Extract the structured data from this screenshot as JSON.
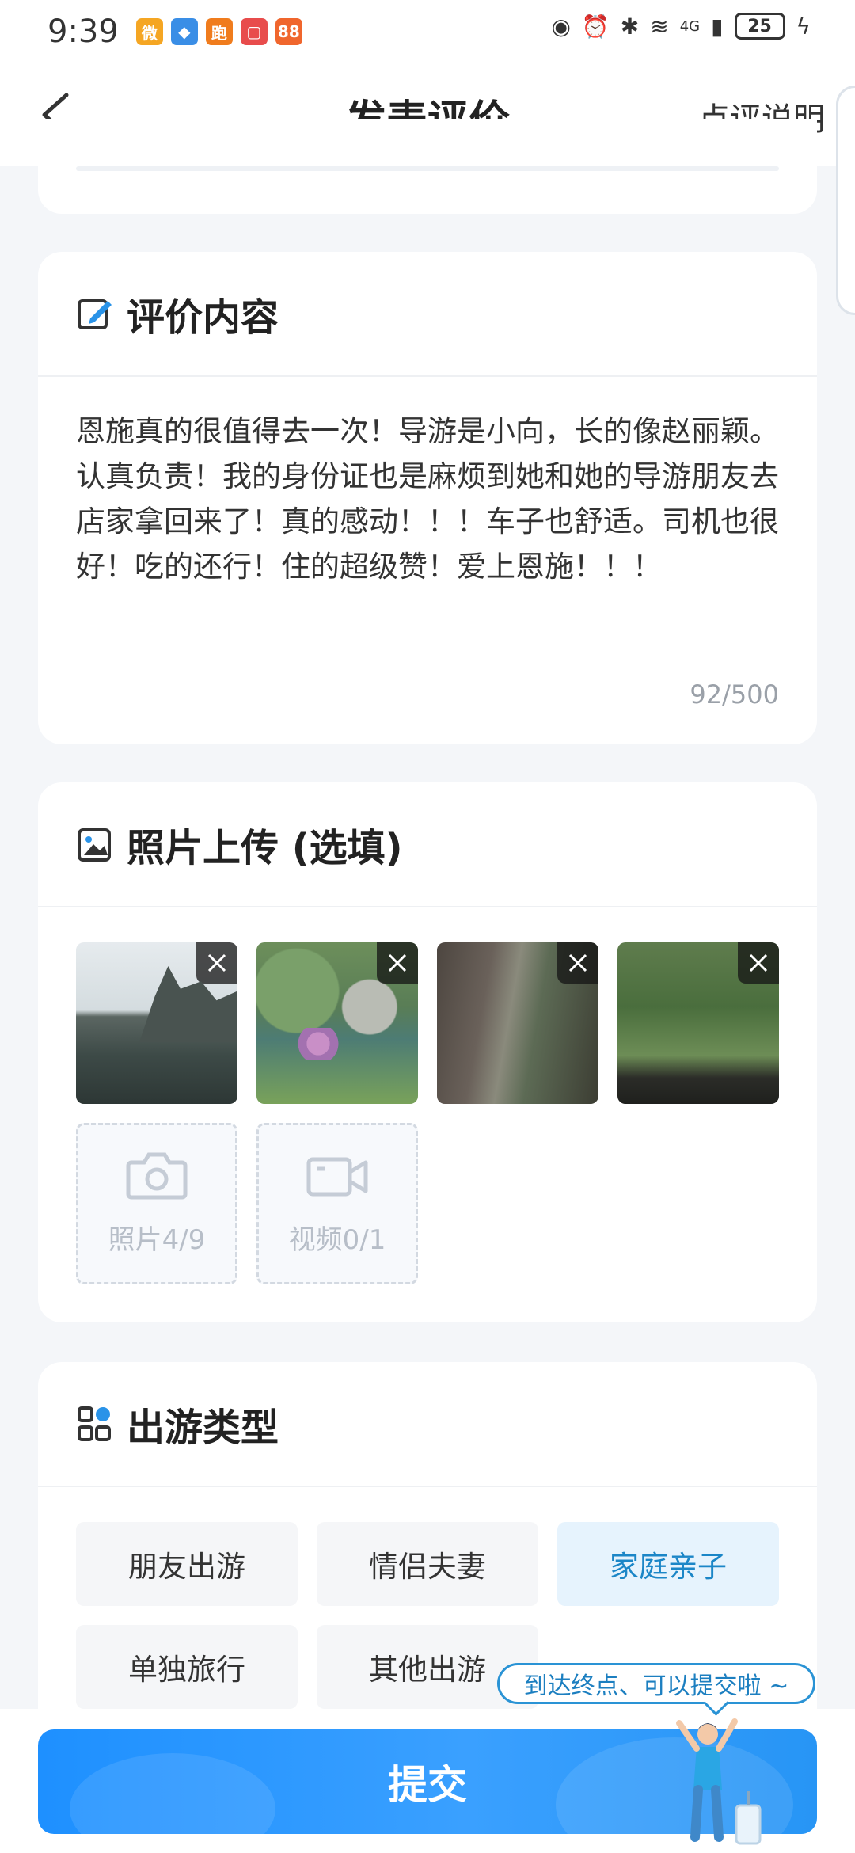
{
  "status_bar": {
    "time": "9:39",
    "apps": [
      {
        "name": "weibo-app-icon",
        "glyph": "微",
        "color": "#f5a623"
      },
      {
        "name": "browser-app-icon",
        "glyph": "◆",
        "color": "#3a8ee6"
      },
      {
        "name": "sport-app-icon",
        "glyph": "跑",
        "color": "#f07c1d"
      },
      {
        "name": "notes-app-icon",
        "glyph": "▢",
        "color": "#e84c4c"
      },
      {
        "name": "apps-grid-icon",
        "glyph": "88",
        "color": "#f0662d"
      }
    ],
    "network": "4G",
    "battery": "25"
  },
  "nav": {
    "title": "发表评价",
    "right_link": "点评说明"
  },
  "review": {
    "section_title": "评价内容",
    "text": "恩施真的很值得去一次！导游是小向，长的像赵丽颖。认真负责！我的身份证也是麻烦到她和她的导游朋友去店家拿回来了！真的感动！！！车子也舒适。司机也很好！吃的还行！住的超级赞！爱上恩施！！！",
    "char_count": "92/500"
  },
  "photos": {
    "section_title": "照片上传 (选填)",
    "uploaded": [
      {
        "name": "photo-thumbnail-river"
      },
      {
        "name": "photo-thumbnail-flowers"
      },
      {
        "name": "photo-thumbnail-canyon"
      },
      {
        "name": "photo-thumbnail-waterfall"
      }
    ],
    "add_photo_label": "照片4/9",
    "add_video_label": "视频0/1"
  },
  "trip_type": {
    "section_title": "出游类型",
    "options": [
      {
        "label": "朋友出游",
        "selected": false
      },
      {
        "label": "情侣夫妻",
        "selected": false
      },
      {
        "label": "家庭亲子",
        "selected": true
      },
      {
        "label": "单独旅行",
        "selected": false
      },
      {
        "label": "其他出游",
        "selected": false
      }
    ]
  },
  "footer": {
    "tip": "到达终点、可以提交啦 ~",
    "submit_label": "提交"
  },
  "colors": {
    "accent": "#1e90ff",
    "selected_chip_bg": "#e6f3fd",
    "selected_chip_text": "#1b86c7"
  }
}
